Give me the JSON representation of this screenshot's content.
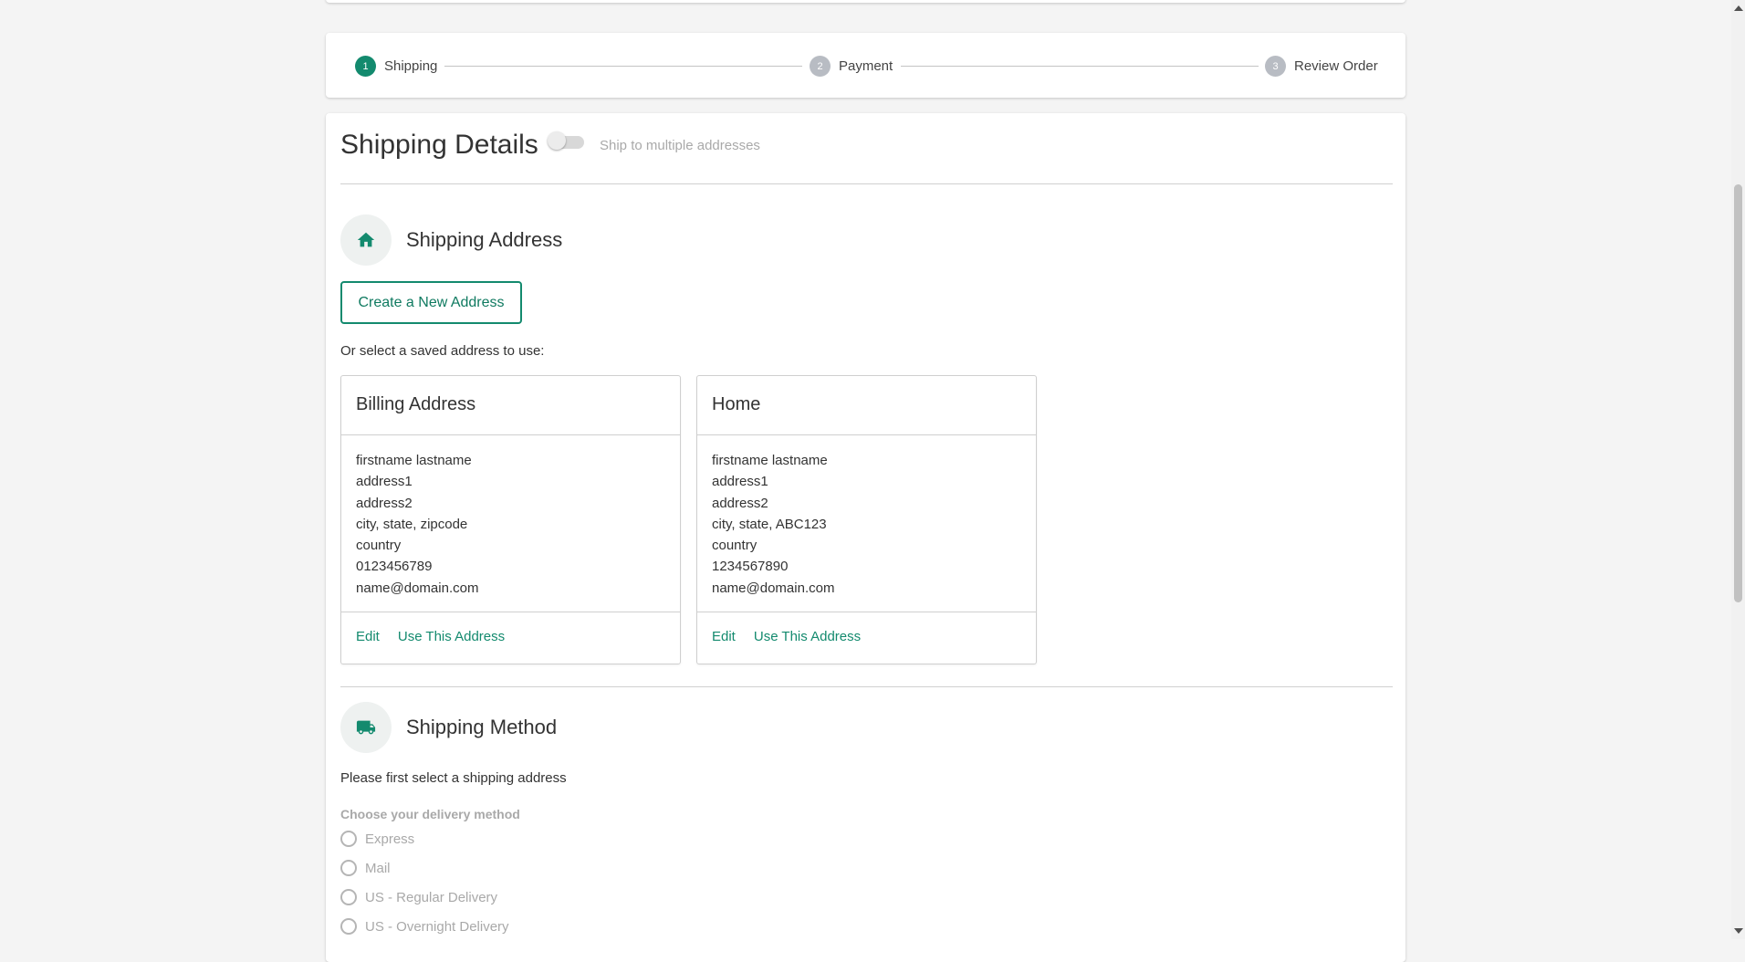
{
  "stepper": {
    "steps": [
      {
        "number": "1",
        "label": "Shipping",
        "state": "active"
      },
      {
        "number": "2",
        "label": "Payment",
        "state": "inactive"
      },
      {
        "number": "3",
        "label": "Review Order",
        "state": "inactive"
      }
    ]
  },
  "shipping_details": {
    "title": "Shipping Details",
    "multi_toggle_label": "Ship to multiple addresses",
    "multi_toggle_on": false
  },
  "shipping_address": {
    "title": "Shipping Address",
    "icon": "home-icon",
    "create_button": "Create a New Address",
    "select_hint": "Or select a saved address to use:",
    "cards": [
      {
        "title": "Billing Address",
        "lines": [
          "firstname lastname",
          "address1",
          "address2",
          "city, state, zipcode",
          "country",
          "0123456789",
          "name@domain.com"
        ],
        "edit_label": "Edit",
        "use_label": "Use This Address"
      },
      {
        "title": "Home",
        "lines": [
          "firstname lastname",
          "address1",
          "address2",
          "city, state, ABC123",
          "country",
          "1234567890",
          "name@domain.com"
        ],
        "edit_label": "Edit",
        "use_label": "Use This Address"
      }
    ]
  },
  "shipping_method": {
    "title": "Shipping Method",
    "icon": "truck-icon",
    "hint": "Please first select a shipping address",
    "delivery_label": "Choose your delivery method",
    "options": [
      "Express",
      "Mail",
      "US - Regular Delivery",
      "US - Overnight Delivery"
    ]
  },
  "colors": {
    "accent": "#138a6e",
    "inactive_step": "#b8bcc3",
    "disabled_text": "#a9a9a9",
    "page_background": "#f4f4f4"
  }
}
